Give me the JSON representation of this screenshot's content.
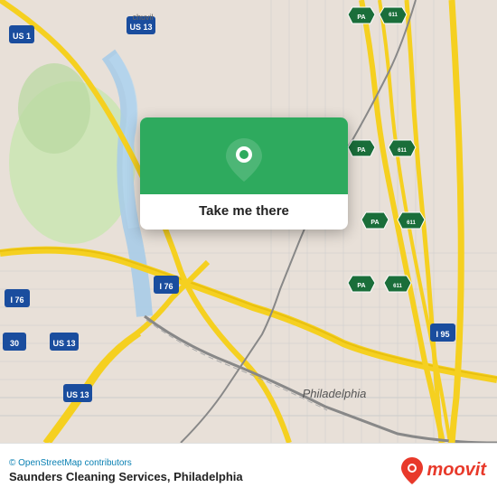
{
  "map": {
    "background_color": "#e8e0d8",
    "attribution": "© OpenStreetMap contributors"
  },
  "popup": {
    "button_label": "Take me there",
    "pin_icon": "location-pin"
  },
  "bottom_bar": {
    "osm_credit": "© OpenStreetMap contributors",
    "location_name": "Saunders Cleaning Services, Philadelphia",
    "logo_text": "moovit"
  }
}
